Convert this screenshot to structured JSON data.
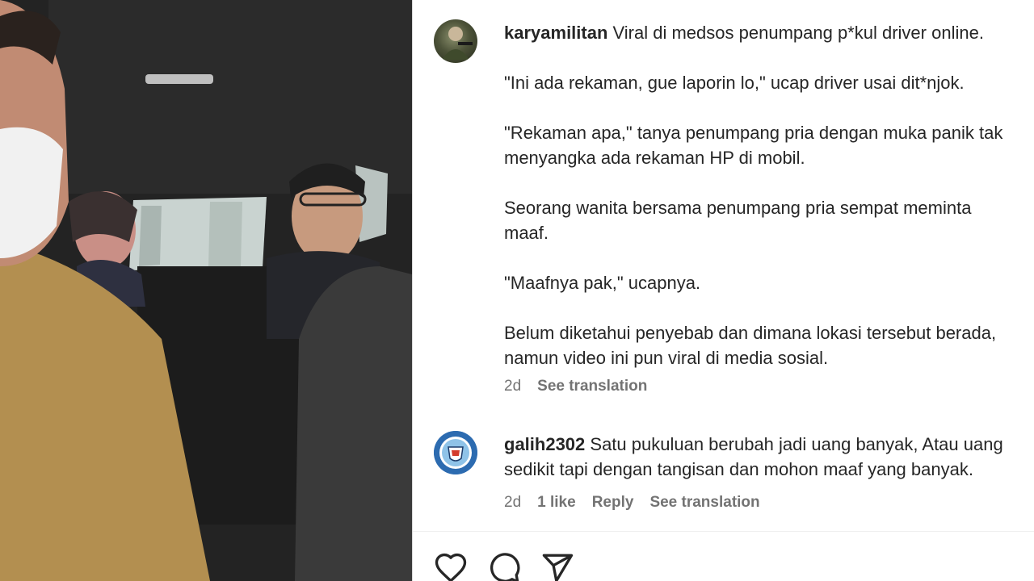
{
  "post": {
    "username": "karyamilitan",
    "caption": " Viral di medsos penumpang p*kul driver online.\n\n\"Ini ada rekaman, gue laporin lo,\" ucap driver usai dit*njok.\n\n\"Rekaman apa,\" tanya penumpang pria dengan muka panik tak\nmenyangka ada rekaman HP di mobil.\n\nSeorang wanita bersama penumpang pria sempat meminta\nmaaf.\n\n\"Maafnya pak,\" ucapnya.\n\nBelum diketahui penyebab dan dimana lokasi tersebut berada,\nnamun video ini pun viral di media sosial.",
    "time": "2d",
    "see_translation": "See translation",
    "avatar_icon": "profile-photo"
  },
  "comment": {
    "username": "galih2302",
    "text": " Satu pukuluan berubah jadi uang banyak, Atau uang\nsedikit tapi dengan tangisan dan mohon maaf yang banyak.",
    "time": "2d",
    "likes": "1 like",
    "reply": "Reply",
    "see_translation": "See translation",
    "avatar_icon": "club-crest-icon"
  },
  "actions": {
    "like_icon": "heart-icon",
    "comment_icon": "comment-icon",
    "share_icon": "send-icon"
  },
  "colors": {
    "text": "#262626",
    "muted": "#737373",
    "crest_blue": "#2c6bb0"
  }
}
